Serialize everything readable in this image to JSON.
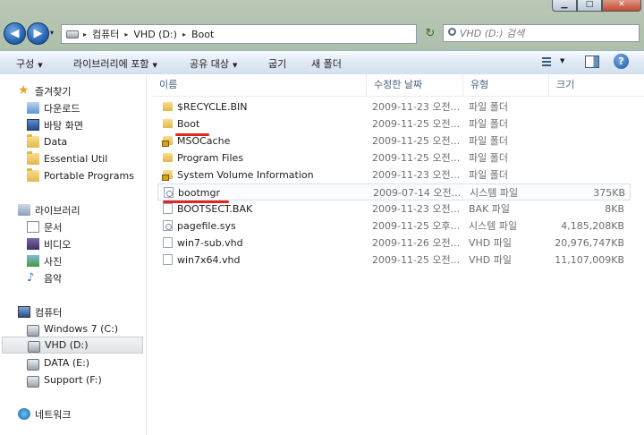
{
  "window": {
    "min_glyph": "▁",
    "max_glyph": "□",
    "close_glyph": "✕"
  },
  "nav": {
    "back_glyph": "◀",
    "forward_glyph": "▶",
    "history_glyph": "▾",
    "address": [
      "컴퓨터",
      "VHD (D:)",
      "Boot"
    ],
    "address_sep": "▸",
    "refresh_glyph": "↻",
    "search_placeholder": "VHD (D:) 검색"
  },
  "toolbar": {
    "organize": "구성",
    "include_library": "라이브러리에 포함",
    "share": "공유 대상",
    "burn": "굽기",
    "new_folder": "새 폴더",
    "arrow": "▼",
    "help": "?"
  },
  "sidebar": {
    "favorites": {
      "label": "즐겨찾기",
      "items": [
        "다운로드",
        "바탕 화면",
        "Data",
        "Essential Util",
        "Portable Programs"
      ]
    },
    "libraries": {
      "label": "라이브러리",
      "items": [
        "문서",
        "비디오",
        "사진",
        "음악"
      ]
    },
    "computer": {
      "label": "컴퓨터",
      "items": [
        "Windows 7 (C:)",
        "VHD (D:)",
        "DATA (E:)",
        "Support (F:)"
      ],
      "selected": "VHD (D:)"
    },
    "network": {
      "label": "네트워크"
    }
  },
  "columns": {
    "name": "이름",
    "modified": "수정한 날짜",
    "type": "유형",
    "size": "크기"
  },
  "files": [
    {
      "name": "$RECYCLE.BIN",
      "modified": "2009-11-23 오전...",
      "type": "파일 폴더",
      "size": "",
      "icon": "folder"
    },
    {
      "name": "Boot",
      "modified": "2009-11-25 오전...",
      "type": "파일 폴더",
      "size": "",
      "icon": "folder"
    },
    {
      "name": "MSOCache",
      "modified": "2009-11-25 오전...",
      "type": "파일 폴더",
      "size": "",
      "icon": "folder-lock"
    },
    {
      "name": "Program Files",
      "modified": "2009-11-25 오전...",
      "type": "파일 폴더",
      "size": "",
      "icon": "folder"
    },
    {
      "name": "System Volume Information",
      "modified": "2009-11-23 오전...",
      "type": "파일 폴더",
      "size": "",
      "icon": "folder-lock"
    },
    {
      "name": "bootmgr",
      "modified": "2009-07-14 오전...",
      "type": "시스템 파일",
      "size": "375KB",
      "icon": "system-file"
    },
    {
      "name": "BOOTSECT.BAK",
      "modified": "2009-11-23 오전...",
      "type": "BAK 파일",
      "size": "8KB",
      "icon": "file"
    },
    {
      "name": "pagefile.sys",
      "modified": "2009-11-25 오후...",
      "type": "시스템 파일",
      "size": "4,185,208KB",
      "icon": "system-file"
    },
    {
      "name": "win7-sub.vhd",
      "modified": "2009-11-26 오전...",
      "type": "VHD 파일",
      "size": "20,976,747KB",
      "icon": "file"
    },
    {
      "name": "win7x64.vhd",
      "modified": "2009-11-25 오전...",
      "type": "VHD 파일",
      "size": "11,107,009KB",
      "icon": "file"
    }
  ],
  "colors": {
    "annotation_underline": "#e1261c",
    "selection_border": "#cfe3f6"
  }
}
